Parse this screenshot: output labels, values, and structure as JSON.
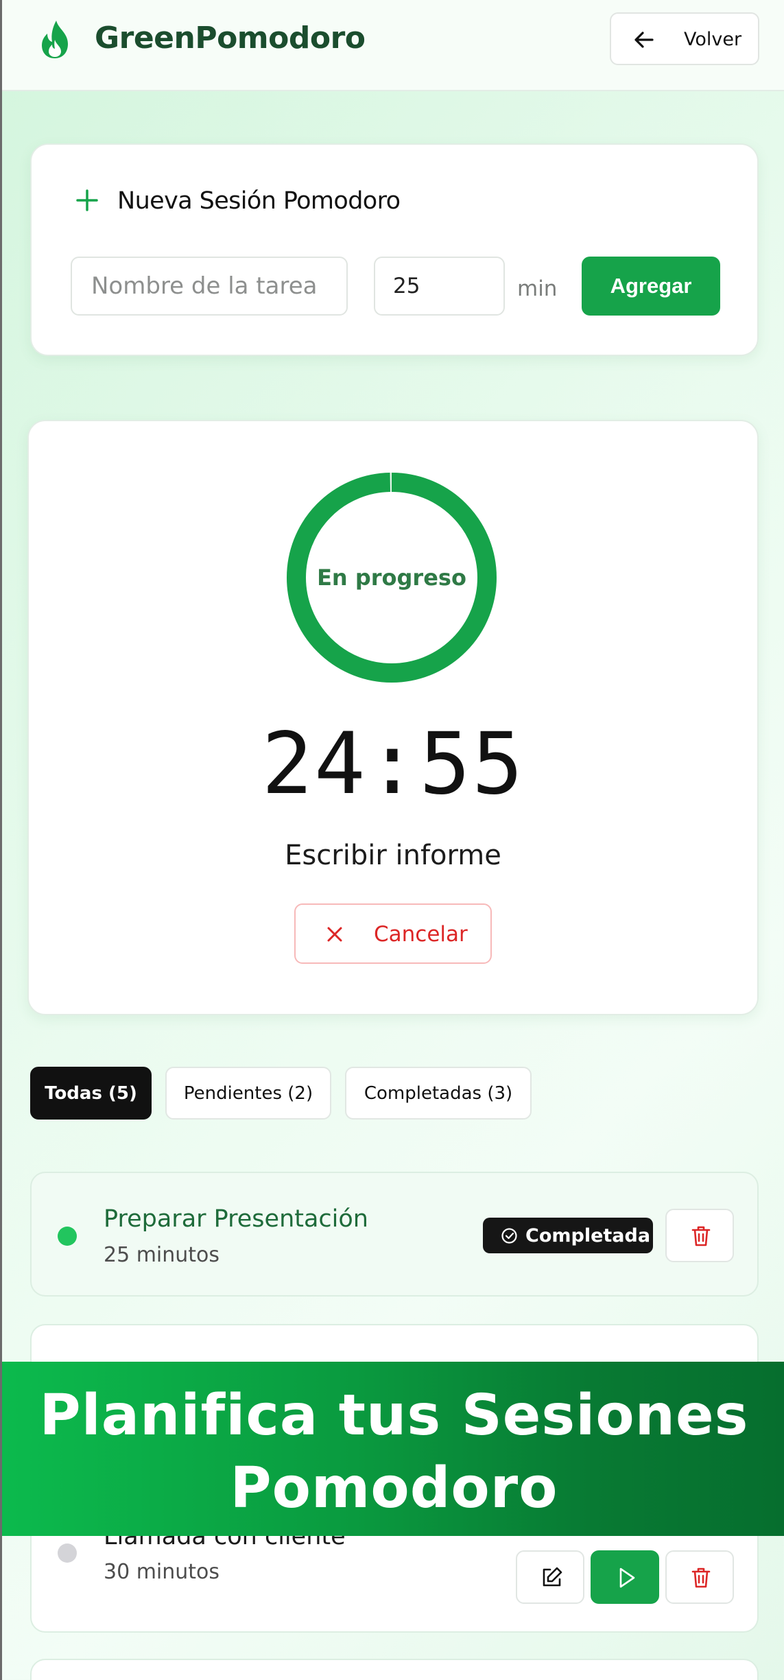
{
  "header": {
    "app_name": "GreenPomodoro",
    "back_label": "Volver"
  },
  "new_session": {
    "title": "Nueva Sesión Pomodoro",
    "task_placeholder": "Nombre de la tarea",
    "task_value": "",
    "minutes_value": "25",
    "minutes_unit": "min",
    "add_label": "Agregar"
  },
  "timer": {
    "status": "En progreso",
    "time": "24:55",
    "task": "Escribir informe",
    "cancel_label": "Cancelar",
    "progress_fraction": 0.997
  },
  "filters": [
    {
      "label": "Todas (5)",
      "active": true
    },
    {
      "label": "Pendientes (2)",
      "active": false
    },
    {
      "label": "Completadas (3)",
      "active": false
    }
  ],
  "tasks": [
    {
      "title": "Preparar Presentación",
      "duration": "25 minutos",
      "status": "completed",
      "badge": "Completada"
    },
    {
      "title": "Llamada con cliente",
      "duration": "30 minutos",
      "status": "pending"
    }
  ],
  "banner": {
    "line1": "Planifica tus Sesiones",
    "line2": "Pomodoro"
  },
  "colors": {
    "brand": "#16a34a",
    "brand_dark": "#1b4d2e",
    "danger": "#dc2626",
    "dot_completed": "#22c55e",
    "dot_pending": "#d4d4d8"
  },
  "icons": {
    "logo": "flame-icon",
    "back": "arrow-left-icon",
    "add": "plus-icon",
    "cancel": "x-icon",
    "badge": "check-circle-icon",
    "delete": "trash-icon",
    "edit": "edit-icon",
    "play": "play-icon"
  }
}
